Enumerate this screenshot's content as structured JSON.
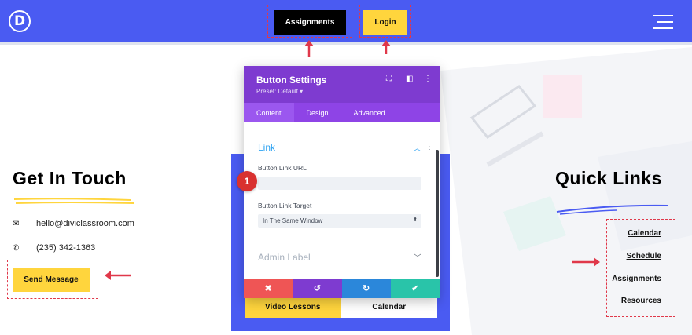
{
  "header": {
    "logo_letter": "D",
    "assignments_label": "Assignments",
    "login_label": "Login"
  },
  "contact": {
    "title": "Get In Touch",
    "email": "hello@diviclassroom.com",
    "phone": "(235) 342-1363",
    "send_label": "Send Message"
  },
  "quick_links": {
    "title": "Quick Links",
    "items": [
      "Calendar",
      "Schedule",
      "Assignments",
      "Resources"
    ]
  },
  "module": {
    "tabs": [
      "Video Lessons",
      "Calendar"
    ]
  },
  "panel": {
    "title": "Button Settings",
    "preset": "Preset: Default ▾",
    "tabs": [
      "Content",
      "Design",
      "Advanced"
    ],
    "link_section": "Link",
    "link_url_label": "Button Link URL",
    "link_url_value": "",
    "link_target_label": "Button Link Target",
    "link_target_value": "In The Same Window",
    "admin_label_section": "Admin Label",
    "actions": [
      "cancel",
      "undo",
      "redo",
      "save"
    ]
  },
  "annotation": {
    "step_number": "1"
  },
  "colors": {
    "header_blue": "#4a5bf2",
    "accent_yellow": "#ffd53d",
    "panel_purple": "#7e3bd0",
    "link_blue": "#2ea3f2",
    "annotation_red": "#e0384a"
  }
}
